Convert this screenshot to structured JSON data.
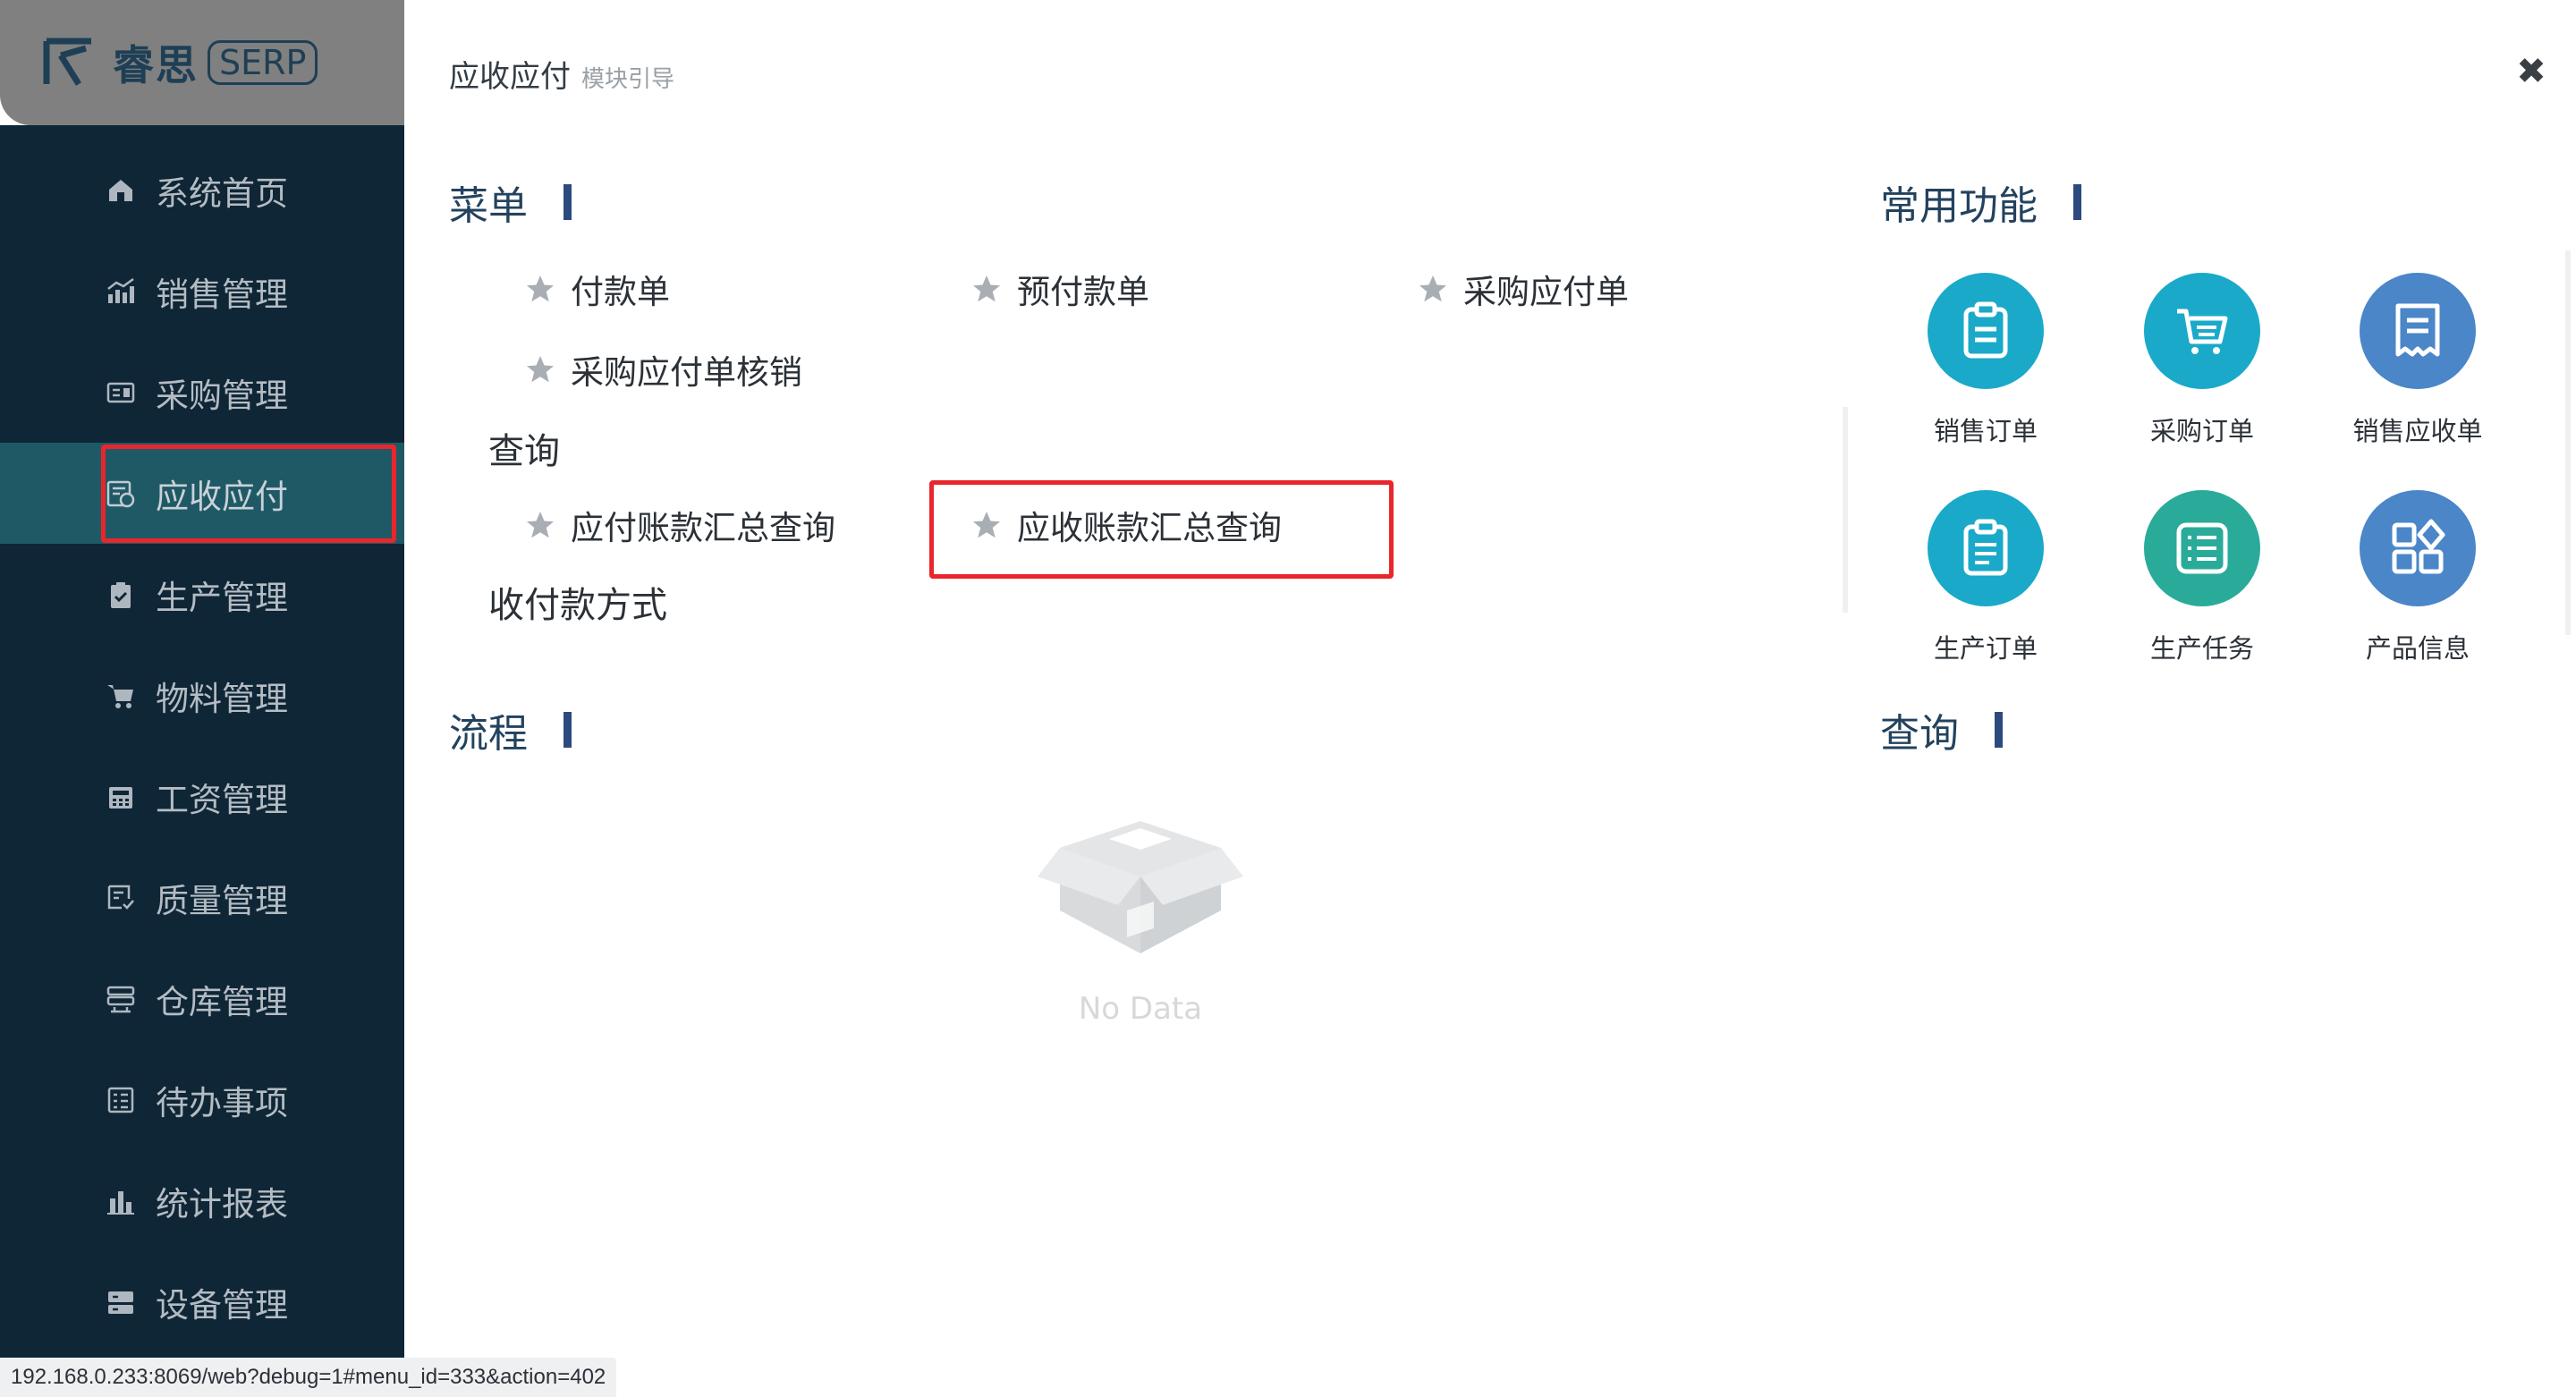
{
  "brand": {
    "name_cn": "睿思",
    "name_en": "SERP"
  },
  "sidebar": {
    "items": [
      {
        "label": "系统首页",
        "icon": "home-icon"
      },
      {
        "label": "销售管理",
        "icon": "chart-icon"
      },
      {
        "label": "采购管理",
        "icon": "purchase-icon"
      },
      {
        "label": "应收应付",
        "icon": "receivable-icon",
        "active": true
      },
      {
        "label": "生产管理",
        "icon": "clipboard-icon"
      },
      {
        "label": "物料管理",
        "icon": "cart-icon"
      },
      {
        "label": "工资管理",
        "icon": "calculator-icon"
      },
      {
        "label": "质量管理",
        "icon": "quality-icon"
      },
      {
        "label": "仓库管理",
        "icon": "warehouse-icon"
      },
      {
        "label": "待办事项",
        "icon": "todo-icon"
      },
      {
        "label": "统计报表",
        "icon": "bar-chart-icon"
      },
      {
        "label": "设备管理",
        "icon": "device-icon"
      }
    ]
  },
  "header": {
    "title": "应收应付",
    "subtitle": "模块引导",
    "close": "✖"
  },
  "menu": {
    "title": "菜单",
    "links": [
      "付款单",
      "预付款单",
      "采购应付单",
      "采购应付单核销"
    ],
    "query_title": "查询",
    "query_links": [
      "应付账款汇总查询",
      "应收账款汇总查询"
    ],
    "payment_methods": "收付款方式"
  },
  "flow": {
    "title": "流程",
    "empty_text": "No Data"
  },
  "common": {
    "title": "常用功能",
    "items": [
      {
        "label": "销售订单",
        "color": "#1aa9c9",
        "icon": "clipboard-icon"
      },
      {
        "label": "采购订单",
        "color": "#1aa9c9",
        "icon": "cart-icon"
      },
      {
        "label": "销售应收单",
        "color": "#4a86c8",
        "icon": "receipt-icon"
      },
      {
        "label": "生产订单",
        "color": "#1aa9c9",
        "icon": "clipboard-icon"
      },
      {
        "label": "生产任务",
        "color": "#2aab9a",
        "icon": "list-icon"
      },
      {
        "label": "产品信息",
        "color": "#4a86c8",
        "icon": "grid-icon"
      }
    ],
    "query_title": "查询"
  },
  "status": {
    "url": "192.168.0.233:8069/web?debug=1#menu_id=333&action=402"
  },
  "colors": {
    "sidebar_bg": "#0f2636",
    "active_item": "#205966",
    "accent_bar": "#2c4a7e",
    "highlight": "#e8262b"
  }
}
